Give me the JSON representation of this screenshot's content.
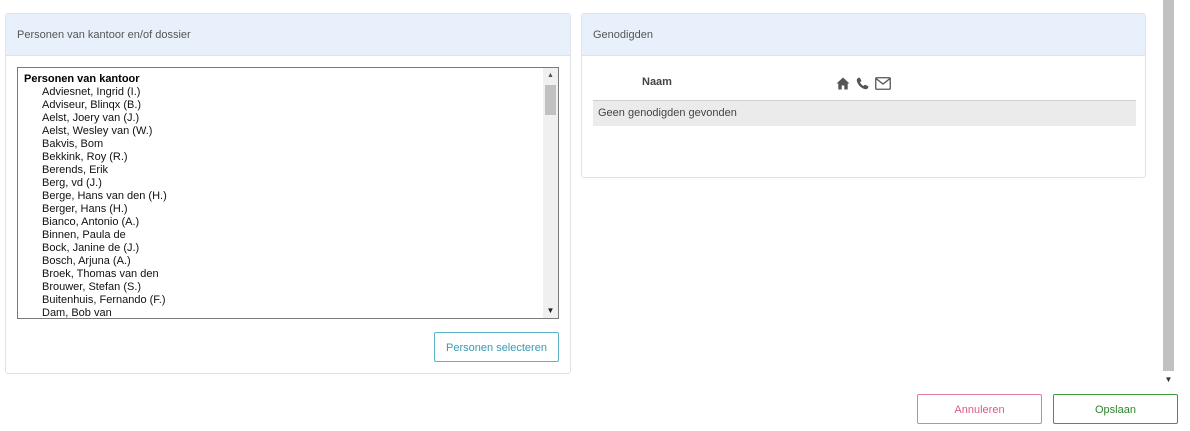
{
  "left_panel": {
    "title": "Personen van kantoor en/of dossier",
    "list": {
      "group_label": "Personen van kantoor",
      "items": [
        "Adviesnet, Ingrid (I.)",
        "Adviseur, Blinqx (B.)",
        "Aelst, Joery van (J.)",
        "Aelst, Wesley van (W.)",
        "Bakvis, Bom",
        "Bekkink, Roy (R.)",
        "Berends, Erik",
        "Berg, vd (J.)",
        "Berge, Hans van den (H.)",
        "Berger, Hans (H.)",
        "Bianco, Antonio (A.)",
        "Binnen, Paula de",
        "Bock, Janine de (J.)",
        "Bosch, Arjuna (A.)",
        "Broek, Thomas van den",
        "Brouwer, Stefan (S.)",
        "Buitenhuis, Fernando (F.)",
        "Dam, Bob van"
      ]
    },
    "select_button": "Personen selecteren"
  },
  "right_panel": {
    "title": "Genodigden",
    "column_name": "Naam",
    "icons": [
      "home-icon",
      "phone-icon",
      "envelope-icon"
    ],
    "empty_message": "Geen genodigden gevonden"
  },
  "footer": {
    "cancel_label": "Annuleren",
    "save_label": "Opslaan"
  },
  "colors": {
    "header_bg": "#e8f1fb",
    "select_button": "#3a9ab5",
    "cancel": "#dc5a8a",
    "save": "#2e852e"
  }
}
